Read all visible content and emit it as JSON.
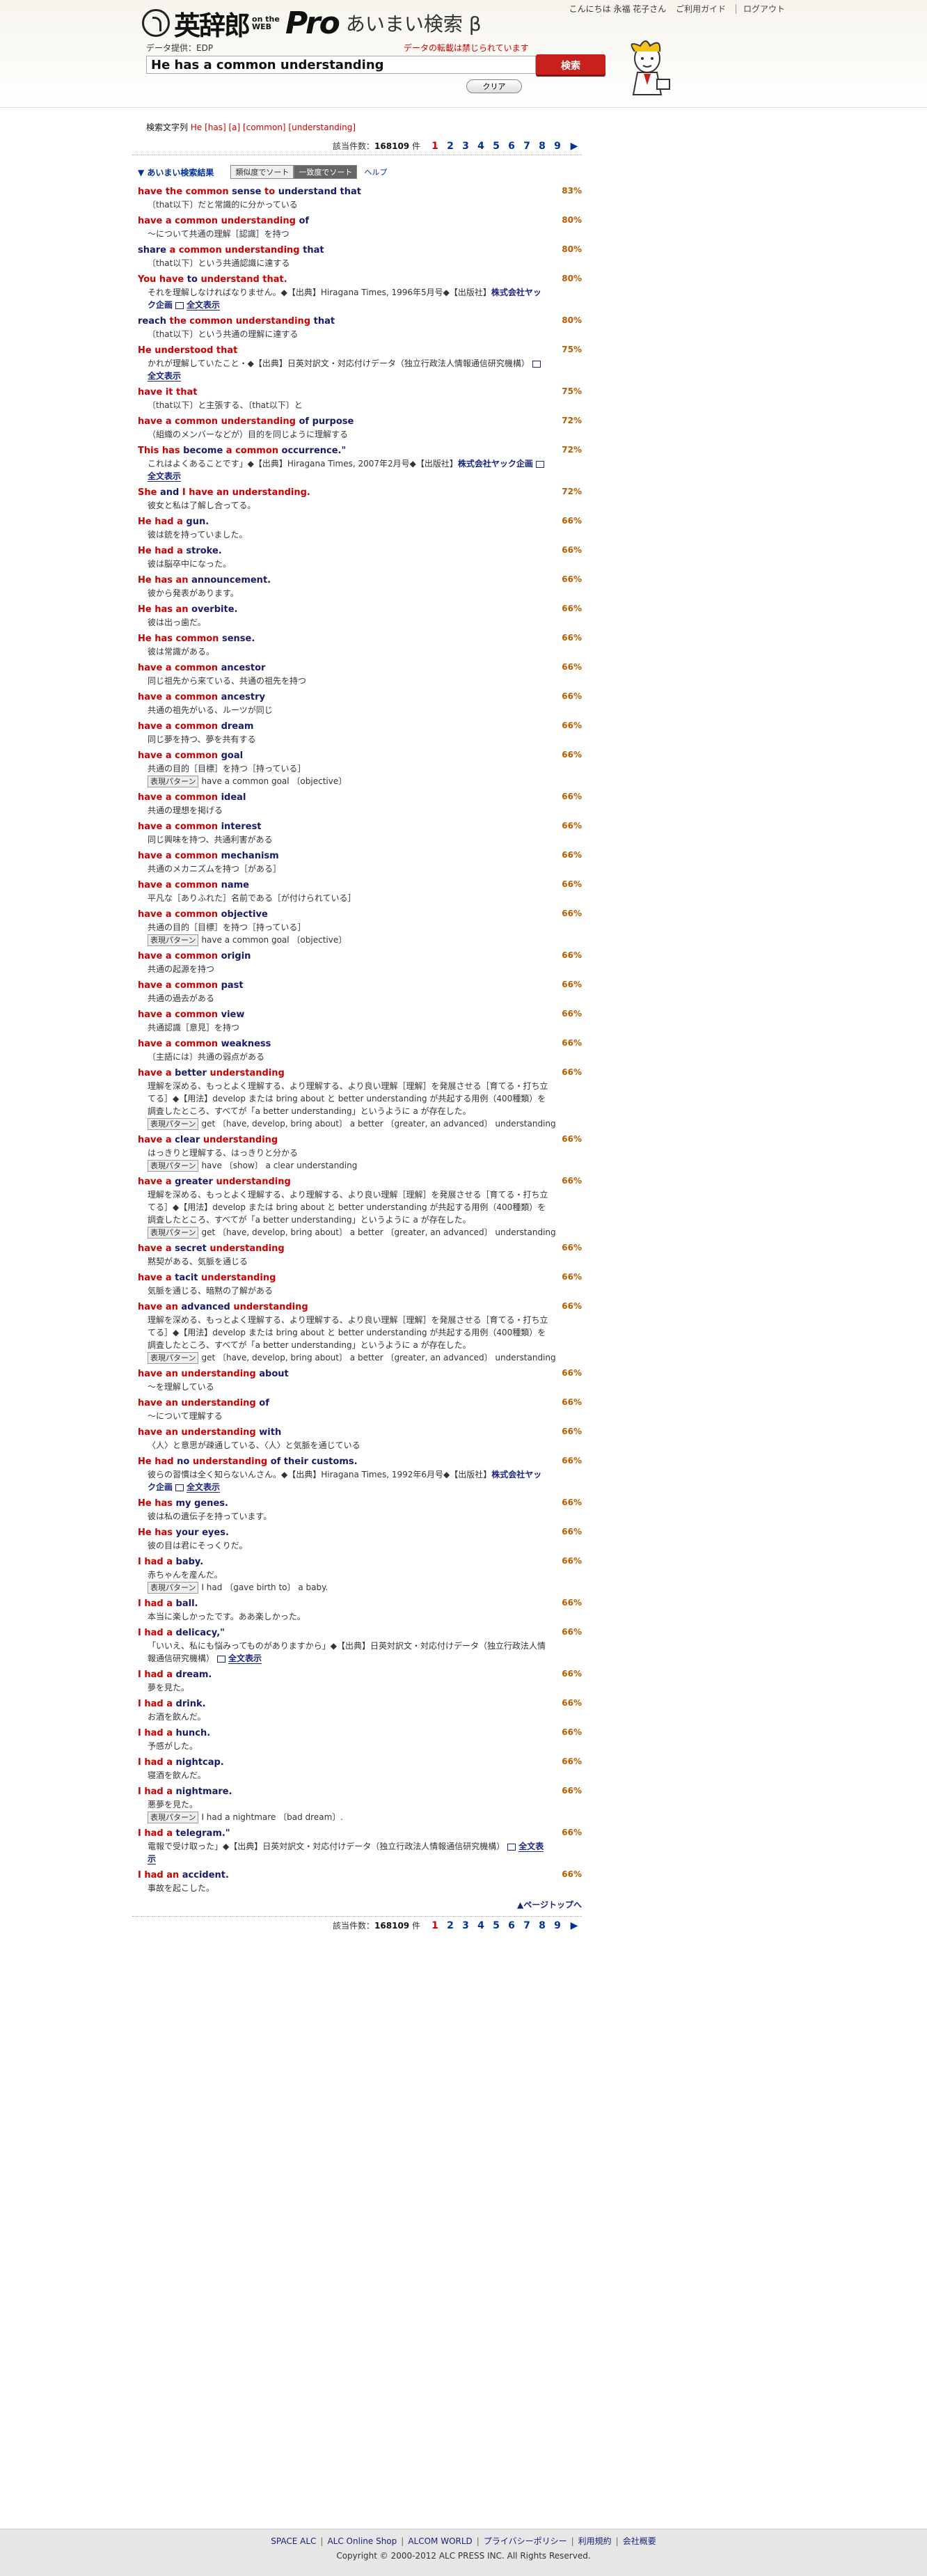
{
  "header": {
    "logo_jp": "英辞郎",
    "logo_ontheweb": "on the WEB",
    "logo_pro": "Pro",
    "logo_sub": "あいまい検索 β",
    "greeting": "こんにちは 永福 花子さん",
    "guide_link": "ご利用ガイド",
    "logout_link": "ログアウト",
    "data_provider": "データ提供：EDP",
    "no_reprint": "データの転載は禁じられています",
    "search_value": "He has a common understanding",
    "search_button": "検索",
    "clear_button": "クリア"
  },
  "query_info": {
    "label": "検索文字列",
    "words": "He [has] [a] [common] [understanding]"
  },
  "pager": {
    "label": "該当件数：",
    "count": "168109",
    "unit": "件",
    "pages": [
      "1",
      "2",
      "3",
      "4",
      "5",
      "6",
      "7",
      "8",
      "9"
    ],
    "next": "▶"
  },
  "results_head": {
    "toggle": "▼ あいまい検索結果",
    "sort_similarity": "類似度でソート",
    "sort_match": "一致度でソート",
    "help": "ヘルプ"
  },
  "results": [
    {
      "h": [
        [
          "r",
          "have the common "
        ],
        [
          "m",
          "sense"
        ],
        [
          "r",
          " to "
        ],
        [
          "m",
          "understand that"
        ]
      ],
      "pct": "83%",
      "d": "〔that以下〕だと常識的に分かっている"
    },
    {
      "h": [
        [
          "r",
          "have a common understanding "
        ],
        [
          "m",
          "of"
        ]
      ],
      "pct": "80%",
      "d": "～について共通の理解［認識］を持つ"
    },
    {
      "h": [
        [
          "m",
          "share "
        ],
        [
          "r",
          "a common understanding "
        ],
        [
          "m",
          "that"
        ]
      ],
      "pct": "80%",
      "d": "〔that以下〕という共通認識に達する"
    },
    {
      "h": [
        [
          "r",
          "You have "
        ],
        [
          "m",
          "to "
        ],
        [
          "r",
          "understand that."
        ]
      ],
      "pct": "80%",
      "d": "それを理解しなければなりません。◆【出典】Hiragana Times, 1996年5月号◆【出版社】",
      "src": "株式会社ヤック企画",
      "full": "全文表示"
    },
    {
      "h": [
        [
          "m",
          "reach "
        ],
        [
          "r",
          "the common understanding "
        ],
        [
          "m",
          "that"
        ]
      ],
      "pct": "80%",
      "d": "〔that以下〕という共通の理解に達する"
    },
    {
      "h": [
        [
          "r",
          "He understood that"
        ]
      ],
      "pct": "75%",
      "d": "かれが理解していたこと・◆【出典】日英対訳文・対応付けデータ（独立行政法人情報通信研究機構）",
      "full": "全文表示"
    },
    {
      "h": [
        [
          "r",
          "have it that"
        ]
      ],
      "pct": "75%",
      "d": "〔that以下〕と主張する、〔that以下〕と"
    },
    {
      "h": [
        [
          "r",
          "have a common understanding "
        ],
        [
          "m",
          "of purpose"
        ]
      ],
      "pct": "72%",
      "d": "（組織のメンバーなどが）目的を同じように理解する"
    },
    {
      "h": [
        [
          "r",
          "This has "
        ],
        [
          "m",
          "become "
        ],
        [
          "r",
          "a common "
        ],
        [
          "m",
          "occurrence.\""
        ]
      ],
      "pct": "72%",
      "d": "これはよくあることです」◆【出典】Hiragana Times, 2007年2月号◆【出版社】",
      "src": "株式会社ヤック企画",
      "full": "全文表示"
    },
    {
      "h": [
        [
          "r",
          "She "
        ],
        [
          "m",
          "and "
        ],
        [
          "r",
          "I have an understanding."
        ]
      ],
      "pct": "72%",
      "d": "彼女と私は了解し合ってる。"
    },
    {
      "h": [
        [
          "r",
          "He had a "
        ],
        [
          "m",
          "gun."
        ]
      ],
      "pct": "66%",
      "d": "彼は銃を持っていました。"
    },
    {
      "h": [
        [
          "r",
          "He had a "
        ],
        [
          "m",
          "stroke."
        ]
      ],
      "pct": "66%",
      "d": "彼は脳卒中になった。"
    },
    {
      "h": [
        [
          "r",
          "He has an "
        ],
        [
          "m",
          "announcement."
        ]
      ],
      "pct": "66%",
      "d": "彼から発表があります。"
    },
    {
      "h": [
        [
          "r",
          "He has an "
        ],
        [
          "m",
          "overbite."
        ]
      ],
      "pct": "66%",
      "d": "彼は出っ歯だ。"
    },
    {
      "h": [
        [
          "r",
          "He has common "
        ],
        [
          "m",
          "sense."
        ]
      ],
      "pct": "66%",
      "d": "彼は常識がある。"
    },
    {
      "h": [
        [
          "r",
          "have a common "
        ],
        [
          "m",
          "ancestor"
        ]
      ],
      "pct": "66%",
      "d": "同じ祖先から来ている、共通の祖先を持つ"
    },
    {
      "h": [
        [
          "r",
          "have a common "
        ],
        [
          "m",
          "ancestry"
        ]
      ],
      "pct": "66%",
      "d": "共通の祖先がいる、ルーツが同じ"
    },
    {
      "h": [
        [
          "r",
          "have a common "
        ],
        [
          "m",
          "dream"
        ]
      ],
      "pct": "66%",
      "d": "同じ夢を持つ、夢を共有する"
    },
    {
      "h": [
        [
          "r",
          "have a common "
        ],
        [
          "m",
          "goal"
        ]
      ],
      "pct": "66%",
      "d": "共通の目的［目標］を持つ［持っている］",
      "p": "have a common goal 〔objective〕"
    },
    {
      "h": [
        [
          "r",
          "have a common "
        ],
        [
          "m",
          "ideal"
        ]
      ],
      "pct": "66%",
      "d": "共通の理想を掲げる"
    },
    {
      "h": [
        [
          "r",
          "have a common "
        ],
        [
          "m",
          "interest"
        ]
      ],
      "pct": "66%",
      "d": "同じ興味を持つ、共通利害がある"
    },
    {
      "h": [
        [
          "r",
          "have a common "
        ],
        [
          "m",
          "mechanism"
        ]
      ],
      "pct": "66%",
      "d": "共通のメカニズムを持つ［がある］"
    },
    {
      "h": [
        [
          "r",
          "have a common "
        ],
        [
          "m",
          "name"
        ]
      ],
      "pct": "66%",
      "d": "平凡な［ありふれた］名前である［が付けられている］"
    },
    {
      "h": [
        [
          "r",
          "have a common "
        ],
        [
          "m",
          "objective"
        ]
      ],
      "pct": "66%",
      "d": "共通の目的［目標］を持つ［持っている］",
      "p": "have a common goal 〔objective〕"
    },
    {
      "h": [
        [
          "r",
          "have a common "
        ],
        [
          "m",
          "origin"
        ]
      ],
      "pct": "66%",
      "d": "共通の起源を持つ"
    },
    {
      "h": [
        [
          "r",
          "have a common "
        ],
        [
          "m",
          "past"
        ]
      ],
      "pct": "66%",
      "d": "共通の過去がある"
    },
    {
      "h": [
        [
          "r",
          "have a common "
        ],
        [
          "m",
          "view"
        ]
      ],
      "pct": "66%",
      "d": "共通認識［意見］を持つ"
    },
    {
      "h": [
        [
          "r",
          "have a common "
        ],
        [
          "m",
          "weakness"
        ]
      ],
      "pct": "66%",
      "d": "〔主語には〕共通の弱点がある"
    },
    {
      "h": [
        [
          "r",
          "have a "
        ],
        [
          "m",
          "better "
        ],
        [
          "r",
          "understanding"
        ]
      ],
      "pct": "66%",
      "d": "理解を深める、もっとよく理解する、より理解する、より良い理解［理解］を発展させる［育てる・打ち立てる］◆【用法】develop または bring about と better understanding が共起する用例（400種類）を調査したところ、すべてが「a better understanding」というように a が存在した。",
      "p": "get 〔have, develop, bring about〕 a better 〔greater, an advanced〕 understanding"
    },
    {
      "h": [
        [
          "r",
          "have a "
        ],
        [
          "m",
          "clear "
        ],
        [
          "r",
          "understanding"
        ]
      ],
      "pct": "66%",
      "d": "はっきりと理解する、はっきりと分かる",
      "p": "have 〔show〕 a clear understanding"
    },
    {
      "h": [
        [
          "r",
          "have a "
        ],
        [
          "m",
          "greater "
        ],
        [
          "r",
          "understanding"
        ]
      ],
      "pct": "66%",
      "d": "理解を深める、もっとよく理解する、より理解する、より良い理解［理解］を発展させる［育てる・打ち立てる］◆【用法】develop または bring about と better understanding が共起する用例（400種類）を調査したところ、すべてが「a better understanding」というように a が存在した。",
      "p": "get 〔have, develop, bring about〕 a better 〔greater, an advanced〕 understanding"
    },
    {
      "h": [
        [
          "r",
          "have a "
        ],
        [
          "m",
          "secret "
        ],
        [
          "r",
          "understanding"
        ]
      ],
      "pct": "66%",
      "d": "黙契がある、気脈を通じる"
    },
    {
      "h": [
        [
          "r",
          "have a "
        ],
        [
          "m",
          "tacit "
        ],
        [
          "r",
          "understanding"
        ]
      ],
      "pct": "66%",
      "d": "気脈を通じる、暗黙の了解がある"
    },
    {
      "h": [
        [
          "r",
          "have an "
        ],
        [
          "m",
          "advanced "
        ],
        [
          "r",
          "understanding"
        ]
      ],
      "pct": "66%",
      "d": "理解を深める、もっとよく理解する、より理解する、より良い理解［理解］を発展させる［育てる・打ち立てる］◆【用法】develop または bring about と better understanding が共起する用例（400種類）を調査したところ、すべてが「a better understanding」というように a が存在した。",
      "p": "get 〔have, develop, bring about〕 a better 〔greater, an advanced〕 understanding"
    },
    {
      "h": [
        [
          "r",
          "have an understanding "
        ],
        [
          "m",
          "about"
        ]
      ],
      "pct": "66%",
      "d": "～を理解している"
    },
    {
      "h": [
        [
          "r",
          "have an understanding "
        ],
        [
          "m",
          "of"
        ]
      ],
      "pct": "66%",
      "d": "～について理解する"
    },
    {
      "h": [
        [
          "r",
          "have an understanding "
        ],
        [
          "m",
          "with"
        ]
      ],
      "pct": "66%",
      "d": "〈人〉と意思が疎通している、〈人〉と気脈を通じている"
    },
    {
      "h": [
        [
          "r",
          "He had "
        ],
        [
          "m",
          "no "
        ],
        [
          "r",
          "understanding "
        ],
        [
          "m",
          "of their customs."
        ]
      ],
      "pct": "66%",
      "d": "彼らの習慣は全く知らないんさん。◆【出典】Hiragana Times, 1992年6月号◆【出版社】",
      "src": "株式会社ヤック企画",
      "full": "全文表示"
    },
    {
      "h": [
        [
          "r",
          "He has "
        ],
        [
          "m",
          "my genes."
        ]
      ],
      "pct": "66%",
      "d": "彼は私の遺伝子を持っています。"
    },
    {
      "h": [
        [
          "r",
          "He has "
        ],
        [
          "m",
          "your eyes."
        ]
      ],
      "pct": "66%",
      "d": "彼の目は君にそっくりだ。"
    },
    {
      "h": [
        [
          "r",
          "I had a "
        ],
        [
          "m",
          "baby."
        ]
      ],
      "pct": "66%",
      "d": "赤ちゃんを産んだ。",
      "p": "I had 〔gave birth to〕 a baby."
    },
    {
      "h": [
        [
          "r",
          "I had a "
        ],
        [
          "m",
          "ball."
        ]
      ],
      "pct": "66%",
      "d": "本当に楽しかったです。ああ楽しかった。"
    },
    {
      "h": [
        [
          "r",
          "I had a "
        ],
        [
          "m",
          "delicacy,\""
        ]
      ],
      "pct": "66%",
      "d": "「いいえ、私にも悩みってものがありますから」◆【出典】日英対訳文・対応付けデータ（独立行政法人情報通信研究機構）",
      "full": "全文表示"
    },
    {
      "h": [
        [
          "r",
          "I had a "
        ],
        [
          "m",
          "dream."
        ]
      ],
      "pct": "66%",
      "d": "夢を見た。"
    },
    {
      "h": [
        [
          "r",
          "I had a "
        ],
        [
          "m",
          "drink."
        ]
      ],
      "pct": "66%",
      "d": "お酒を飲んだ。"
    },
    {
      "h": [
        [
          "r",
          "I had a "
        ],
        [
          "m",
          "hunch."
        ]
      ],
      "pct": "66%",
      "d": "予感がした。"
    },
    {
      "h": [
        [
          "r",
          "I had a "
        ],
        [
          "m",
          "nightcap."
        ]
      ],
      "pct": "66%",
      "d": "寝酒を飲んだ。"
    },
    {
      "h": [
        [
          "r",
          "I had a "
        ],
        [
          "m",
          "nightmare."
        ]
      ],
      "pct": "66%",
      "d": "悪夢を見た。",
      "p": "I had a nightmare 〔bad dream〕."
    },
    {
      "h": [
        [
          "r",
          "I had a "
        ],
        [
          "m",
          "telegram.\""
        ]
      ],
      "pct": "66%",
      "d": "電報で受け取った」◆【出典】日英対訳文・対応付けデータ（独立行政法人情報通信研究機構）",
      "full": "全文表示"
    },
    {
      "h": [
        [
          "r",
          "I had an "
        ],
        [
          "m",
          "accident."
        ]
      ],
      "pct": "66%",
      "d": "事故を起こした。"
    }
  ],
  "pattern_tag": "表現パターン",
  "pagetop": "▲ページトップへ",
  "footer": {
    "links": [
      "SPACE ALC",
      "ALC Online Shop",
      "ALCOM WORLD",
      "プライバシーポリシー",
      "利用規約",
      "会社概要"
    ],
    "copyright": "Copyright © 2000-2012 ALC PRESS INC. All Rights Reserved."
  }
}
